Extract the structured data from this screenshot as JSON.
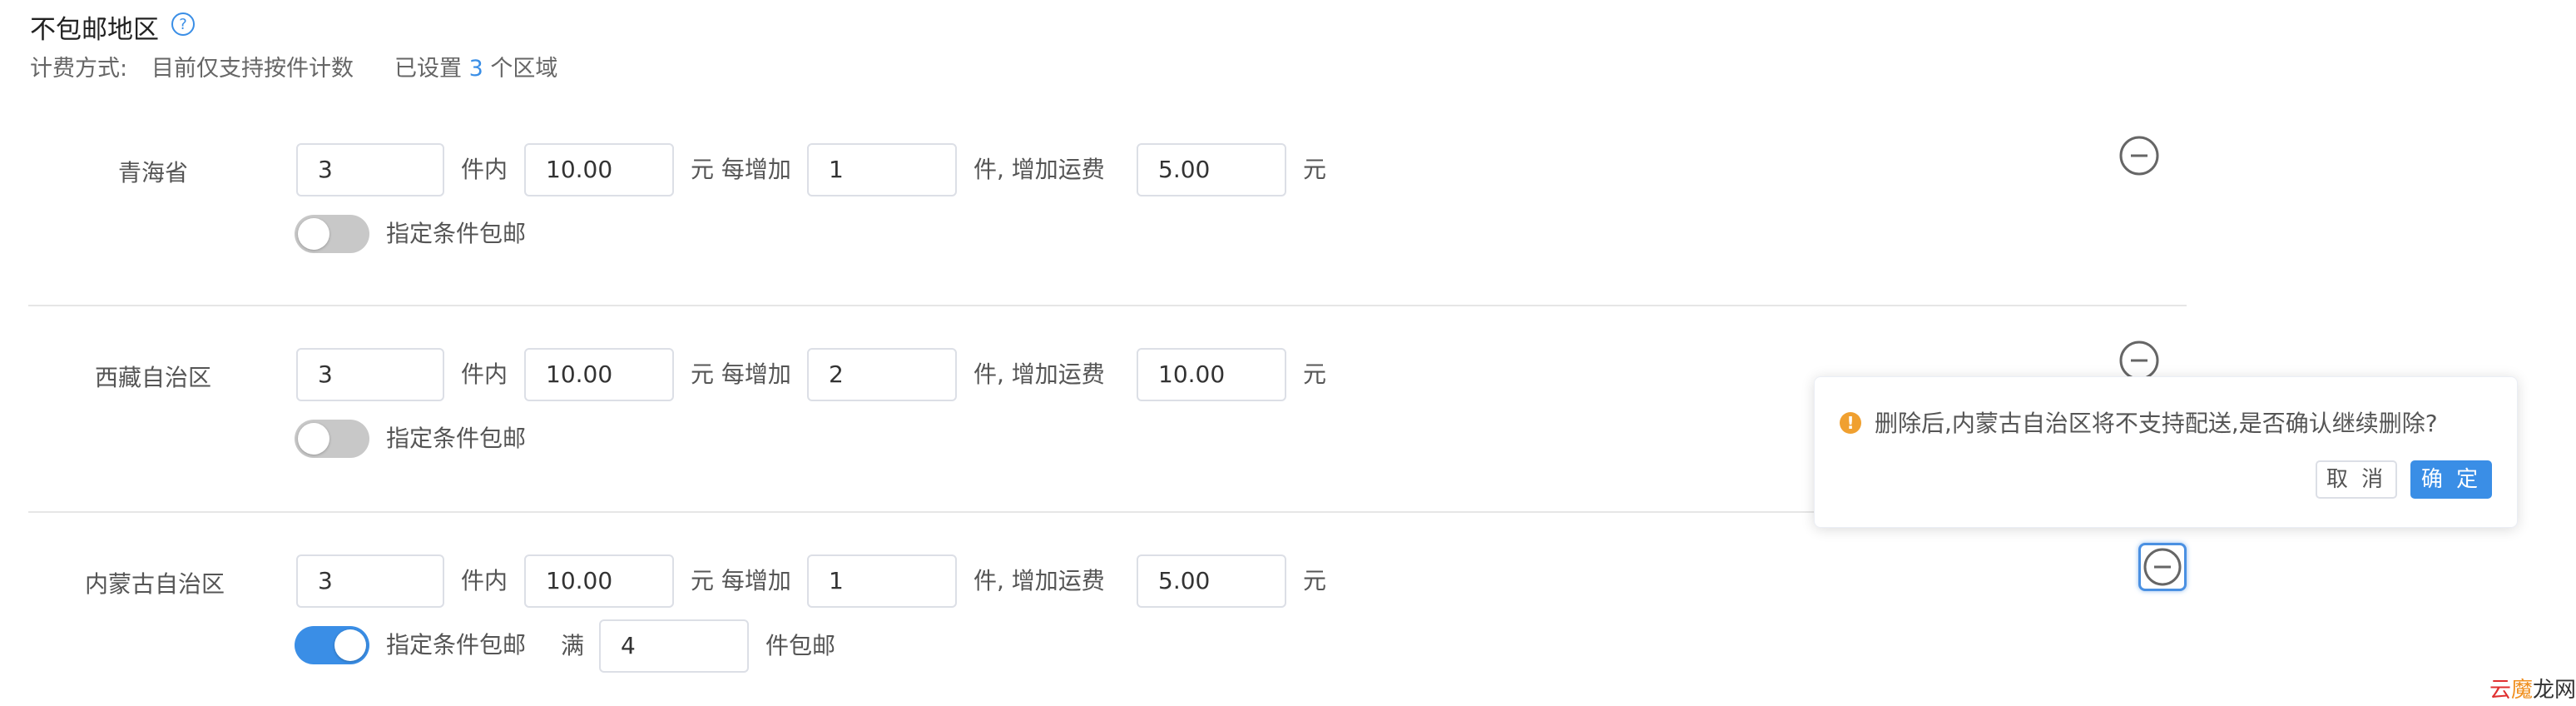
{
  "header": {
    "title": "不包邮地区",
    "billing_label": "计费方式:",
    "billing_value": "目前仅支持按件计数",
    "set_prefix": "已设置",
    "set_count": "3",
    "set_suffix": "个区域"
  },
  "labels": {
    "within_items": "件内",
    "yuan_each_add": "元 每增加",
    "item_add_fee": "件,  增加运费",
    "yuan": "元",
    "free_condition": "指定条件包邮",
    "full": "满",
    "items_free": "件包邮"
  },
  "regions": [
    {
      "name": "青海省",
      "first_qty": "3",
      "first_fee": "10.00",
      "add_qty": "1",
      "add_fee": "5.00",
      "free_enabled": false
    },
    {
      "name": "西藏自治区",
      "first_qty": "3",
      "first_fee": "10.00",
      "add_qty": "2",
      "add_fee": "10.00",
      "free_enabled": false
    },
    {
      "name": "内蒙古自治区",
      "first_qty": "3",
      "first_fee": "10.00",
      "add_qty": "1",
      "add_fee": "5.00",
      "free_enabled": true,
      "free_qty": "4"
    }
  ],
  "popover": {
    "message": "删除后,内蒙古自治区将不支持配送,是否确认继续删除?",
    "cancel_label": "取 消",
    "confirm_label": "确 定"
  },
  "watermark": {
    "part1": "云",
    "part2": "魔",
    "part3": "龙网"
  },
  "colors": {
    "accent": "#3a8ee6",
    "warning": "#f0a030",
    "toggle_off": "#c8c8c8"
  },
  "icons": {
    "help": "help-circle-icon",
    "remove": "minus-circle-icon",
    "warning": "warning-icon"
  }
}
